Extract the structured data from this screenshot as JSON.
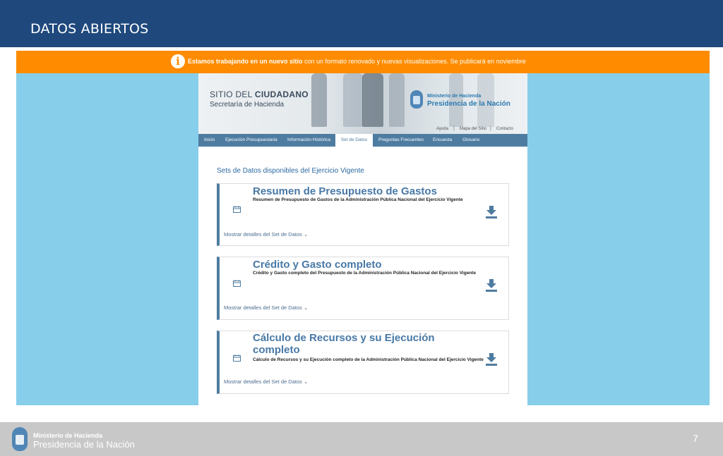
{
  "slide": {
    "title": "DATOS ABIERTOS",
    "page_number": "7"
  },
  "notice": {
    "icon": "info-icon",
    "bold_text": "Estamos trabajando en un nuevo sitio",
    "text": " con un formato renovado y nuevas visualizaciones. Se publicará en noviembre"
  },
  "site": {
    "name_prefix": "SITIO DEL ",
    "name_bold": "CIUDADANO",
    "subtitle": "Secretaría de Hacienda",
    "logo_top": "Ministerio de Hacienda",
    "logo_bottom": "Presidencia de la Nación",
    "utility_links": [
      "Ayuda",
      "Mapa del Sitio",
      "Contacto"
    ],
    "nav": [
      "Inicio",
      "Ejecución Presupuestaria",
      "Información Histórica",
      "Set de Datos",
      "Preguntas Frecuentes",
      "Encuesta",
      "Glosario"
    ],
    "nav_active": "Set de Datos",
    "sets_title": "Sets de Datos disponibles del Ejercicio Vigente",
    "cards": [
      {
        "title": "Resumen de Presupuesto de Gastos",
        "description": "Resumen de Presupuesto de Gastos de la Administración Pública Nacional del Ejercicio Vigente",
        "details": "Mostrar detalles del Set de Datos ⌄"
      },
      {
        "title": "Crédito y Gasto completo",
        "description": "Crédito y Gasto completo del Presupuesto de la Administración Pública Nacional del Ejercicio Vigente",
        "details": "Mostrar detalles del Set de Datos ⌄"
      },
      {
        "title_line1": "Cálculo de Recursos y su Ejecución",
        "title_line2": "completo",
        "description": "Cálculo de Recursos y su Ejecución completo de la Administración Pública Nacional del Ejercicio Vigente",
        "details": "Mostrar detalles del Set de Datos ⌄"
      }
    ]
  },
  "footer": {
    "top": "Ministerio de Hacienda",
    "bottom": "Presidencia de la Nación"
  },
  "colors": {
    "header": "#1f497d",
    "notice": "#ff8c00",
    "background": "#87ceeb",
    "nav": "#4e7ca1",
    "footer": "#c8c8c8"
  }
}
